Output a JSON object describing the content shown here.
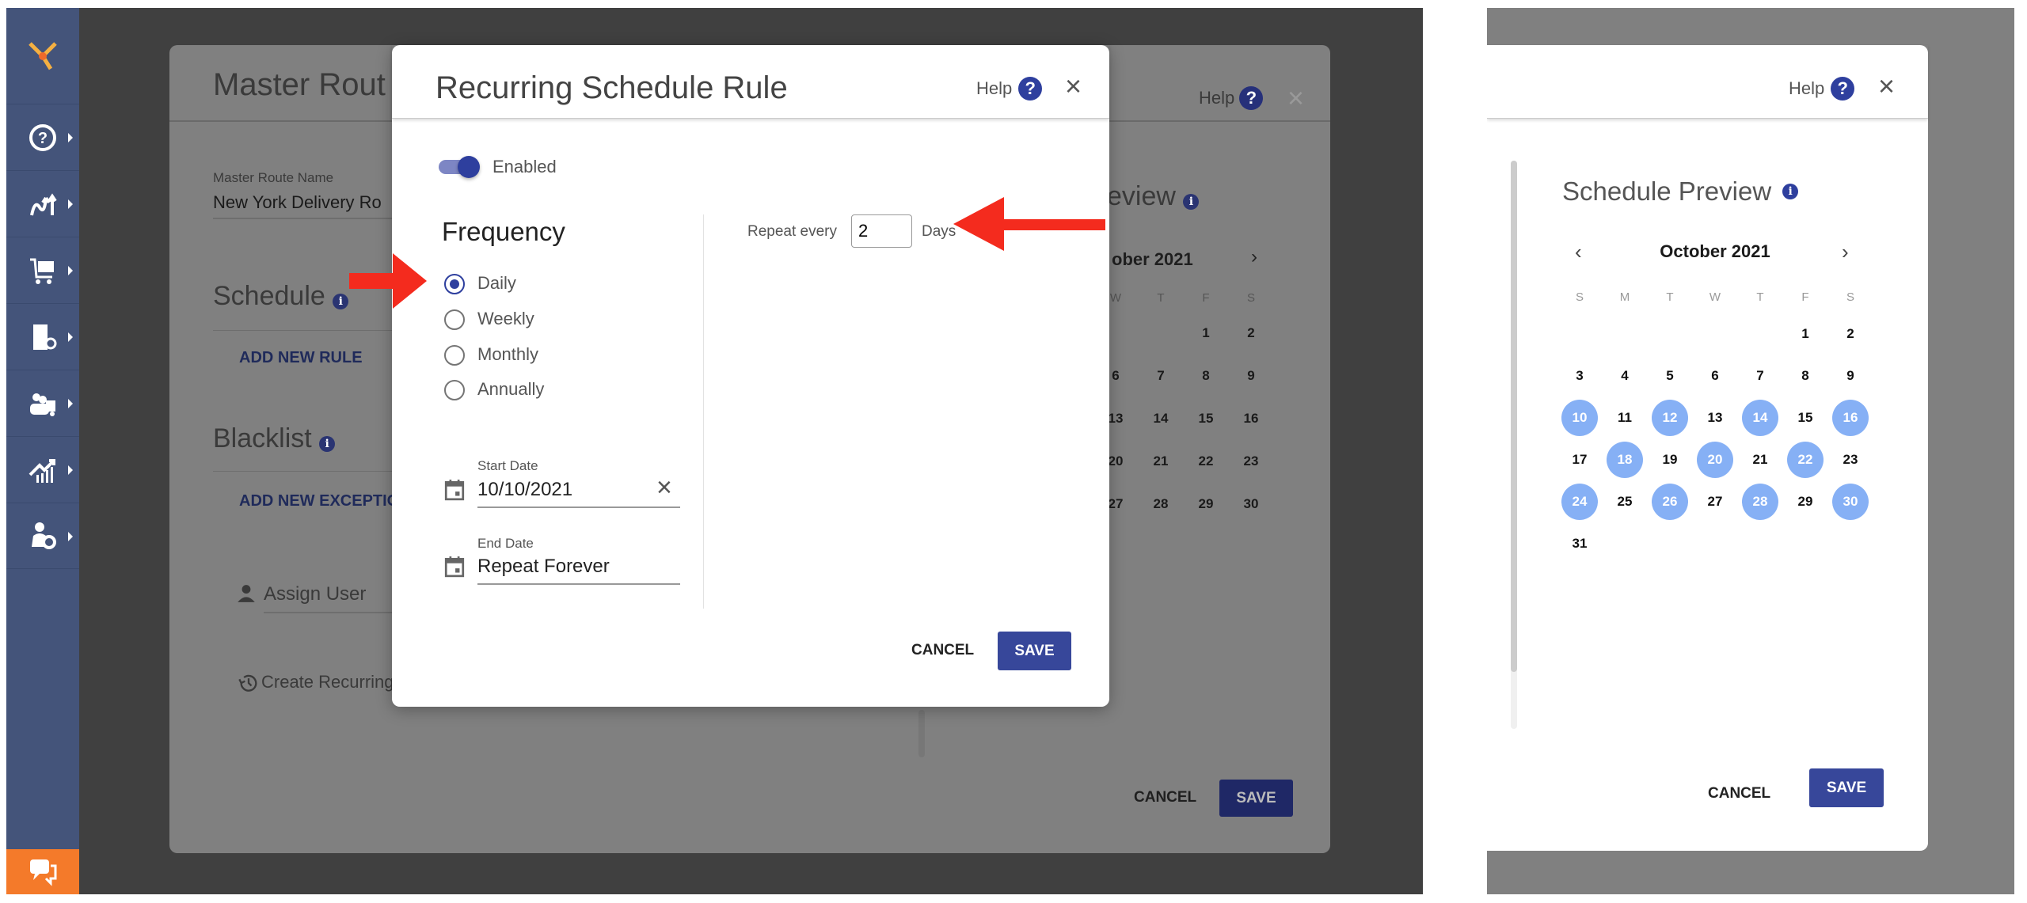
{
  "sidebar": {
    "items": [
      "help",
      "routes",
      "orders",
      "route-plans",
      "team",
      "analytics",
      "user-settings"
    ]
  },
  "background_panel": {
    "title": "Master Rout",
    "route_name_label": "Master Route Name",
    "route_name_value": "New York Delivery Ro",
    "schedule_heading": "Schedule",
    "add_rule": "ADD NEW RULE",
    "blacklist_heading": "Blacklist",
    "add_exception": "ADD NEW EXCEPTION",
    "assign_user": "Assign User",
    "create_recurring": "Create Recurring R",
    "help": "Help",
    "preview_partial": "eview",
    "calendar_title_partial": "ober 2021",
    "cancel": "CANCEL",
    "save": "SAVE"
  },
  "modal": {
    "title": "Recurring Schedule Rule",
    "help": "Help",
    "enabled_label": "Enabled",
    "enabled": true,
    "frequency_heading": "Frequency",
    "frequency_options": [
      "Daily",
      "Weekly",
      "Monthly",
      "Annually"
    ],
    "frequency_selected": "Daily",
    "repeat_every_label": "Repeat every",
    "repeat_every_value": "2",
    "repeat_unit": "Days",
    "start_date_label": "Start Date",
    "start_date_value": "10/10/2021",
    "end_date_label": "End Date",
    "end_date_value": "Repeat Forever",
    "cancel": "CANCEL",
    "save": "SAVE"
  },
  "preview": {
    "help": "Help",
    "title": "Schedule Preview",
    "month": "October 2021",
    "weekdays": [
      "S",
      "M",
      "T",
      "W",
      "T",
      "F",
      "S"
    ],
    "weeks": [
      [
        "",
        "",
        "",
        "",
        "",
        "1",
        "2"
      ],
      [
        "3",
        "4",
        "5",
        "6",
        "7",
        "8",
        "9"
      ],
      [
        "10",
        "11",
        "12",
        "13",
        "14",
        "15",
        "16"
      ],
      [
        "17",
        "18",
        "19",
        "20",
        "21",
        "22",
        "23"
      ],
      [
        "24",
        "25",
        "26",
        "27",
        "28",
        "29",
        "30"
      ],
      [
        "31",
        "",
        "",
        "",
        "",
        "",
        ""
      ]
    ],
    "highlighted": [
      "10",
      "12",
      "14",
      "16",
      "18",
      "20",
      "22",
      "24",
      "26",
      "28",
      "30"
    ],
    "cancel": "CANCEL",
    "save": "SAVE"
  },
  "colors": {
    "primary": "#37479a",
    "highlight": "#86b0f5",
    "sidebar": "#44547a",
    "chat": "#f47a2a",
    "annotation_arrow": "#f42b1e"
  }
}
